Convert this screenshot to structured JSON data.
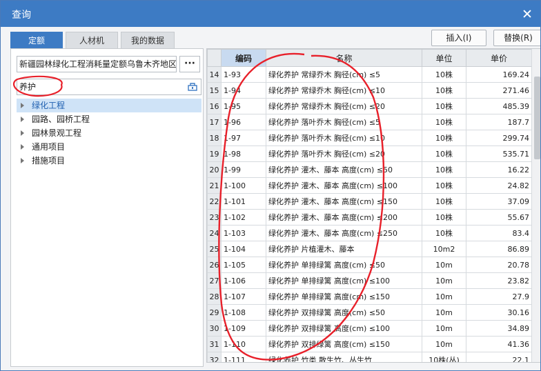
{
  "window": {
    "title": "查询"
  },
  "tabs": [
    {
      "label": "定额",
      "active": true
    },
    {
      "label": "人材机",
      "active": false
    },
    {
      "label": "我的数据",
      "active": false
    }
  ],
  "buttons": {
    "insert": "插入(I)",
    "replace": "替换(R)"
  },
  "library": {
    "value": "新疆园林绿化工程消耗量定额乌鲁木齐地区单",
    "more": "···"
  },
  "search": {
    "value": "养护"
  },
  "tree": [
    {
      "label": "绿化工程",
      "selected": true
    },
    {
      "label": "园路、园桥工程",
      "selected": false
    },
    {
      "label": "园林景观工程",
      "selected": false
    },
    {
      "label": "通用项目",
      "selected": false
    },
    {
      "label": "措施项目",
      "selected": false
    }
  ],
  "table": {
    "headers": {
      "code": "编码",
      "name": "名称",
      "unit": "单位",
      "price": "单价"
    },
    "rows": [
      {
        "idx": "14",
        "code": "1-93",
        "name": "绿化养护 常绿乔木 胸径(cm) ≤5",
        "unit": "10株",
        "price": "169.24"
      },
      {
        "idx": "15",
        "code": "1-94",
        "name": "绿化养护 常绿乔木 胸径(cm) ≤10",
        "unit": "10株",
        "price": "271.46"
      },
      {
        "idx": "16",
        "code": "1-95",
        "name": "绿化养护 常绿乔木 胸径(cm) ≤20",
        "unit": "10株",
        "price": "485.39"
      },
      {
        "idx": "17",
        "code": "1-96",
        "name": "绿化养护 落叶乔木 胸径(cm) ≤5",
        "unit": "10株",
        "price": "187.7"
      },
      {
        "idx": "18",
        "code": "1-97",
        "name": "绿化养护 落叶乔木 胸径(cm) ≤10",
        "unit": "10株",
        "price": "299.74"
      },
      {
        "idx": "19",
        "code": "1-98",
        "name": "绿化养护 落叶乔木 胸径(cm) ≤20",
        "unit": "10株",
        "price": "535.71"
      },
      {
        "idx": "20",
        "code": "1-99",
        "name": "绿化养护 灌木、藤本 高度(cm) ≤50",
        "unit": "10株",
        "price": "16.22"
      },
      {
        "idx": "21",
        "code": "1-100",
        "name": "绿化养护 灌木、藤本 高度(cm) ≤100",
        "unit": "10株",
        "price": "24.82"
      },
      {
        "idx": "22",
        "code": "1-101",
        "name": "绿化养护 灌木、藤本 高度(cm) ≤150",
        "unit": "10株",
        "price": "37.09"
      },
      {
        "idx": "23",
        "code": "1-102",
        "name": "绿化养护 灌木、藤本 高度(cm) ≤200",
        "unit": "10株",
        "price": "55.67"
      },
      {
        "idx": "24",
        "code": "1-103",
        "name": "绿化养护 灌木、藤本 高度(cm) ≤250",
        "unit": "10株",
        "price": "83.4"
      },
      {
        "idx": "25",
        "code": "1-104",
        "name": "绿化养护 片植灌木、藤本",
        "unit": "10m2",
        "price": "86.89"
      },
      {
        "idx": "26",
        "code": "1-105",
        "name": "绿化养护 单排绿篱 高度(cm) ≤50",
        "unit": "10m",
        "price": "20.78"
      },
      {
        "idx": "27",
        "code": "1-106",
        "name": "绿化养护 单排绿篱 高度(cm) ≤100",
        "unit": "10m",
        "price": "23.82"
      },
      {
        "idx": "28",
        "code": "1-107",
        "name": "绿化养护 单排绿篱 高度(cm) ≤150",
        "unit": "10m",
        "price": "27.9"
      },
      {
        "idx": "29",
        "code": "1-108",
        "name": "绿化养护 双排绿篱 高度(cm) ≤50",
        "unit": "10m",
        "price": "30.16"
      },
      {
        "idx": "30",
        "code": "1-109",
        "name": "绿化养护 双排绿篱 高度(cm) ≤100",
        "unit": "10m",
        "price": "34.89"
      },
      {
        "idx": "31",
        "code": "1-110",
        "name": "绿化养护 双排绿篱 高度(cm) ≤150",
        "unit": "10m",
        "price": "41.36"
      },
      {
        "idx": "32",
        "code": "1-111",
        "name": "绿化养护 竹类 散生竹、丛生竹",
        "unit": "10株(丛)",
        "price": "22.1"
      }
    ]
  },
  "colors": {
    "accent": "#3d7bc4",
    "annotation": "#e8202a"
  }
}
